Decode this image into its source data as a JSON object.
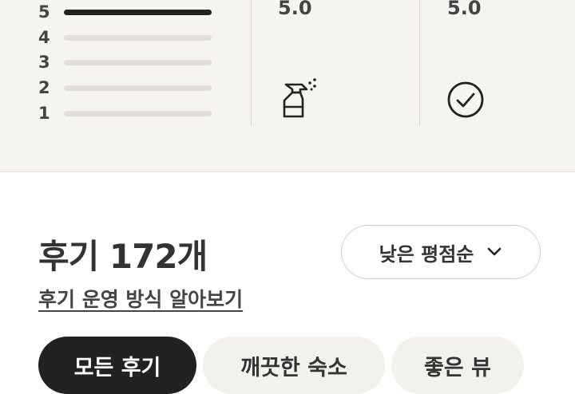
{
  "rating_breakdown": {
    "rows": [
      {
        "label": "5",
        "fill": 1.0
      },
      {
        "label": "4",
        "fill": 0.0
      },
      {
        "label": "3",
        "fill": 0.0
      },
      {
        "label": "2",
        "fill": 0.0
      },
      {
        "label": "1",
        "fill": 0.0
      }
    ]
  },
  "categories": [
    {
      "score": "5.0",
      "icon": "spray-bottle-icon"
    },
    {
      "score": "5.0",
      "icon": "checkmark-circle-icon"
    }
  ],
  "reviews": {
    "title": "후기 172개",
    "policy_link": "후기 운영 방식 알아보기",
    "sort_label": "낮은 평점순"
  },
  "filters": [
    {
      "label": "모든 후기",
      "active": true
    },
    {
      "label": "깨끗한 숙소",
      "active": false
    },
    {
      "label": "좋은 뷰",
      "active": false
    }
  ],
  "colors": {
    "panel_bg": "#f6f4ef",
    "active_chip": "#222222",
    "bar_track": "#e2dfd8"
  }
}
